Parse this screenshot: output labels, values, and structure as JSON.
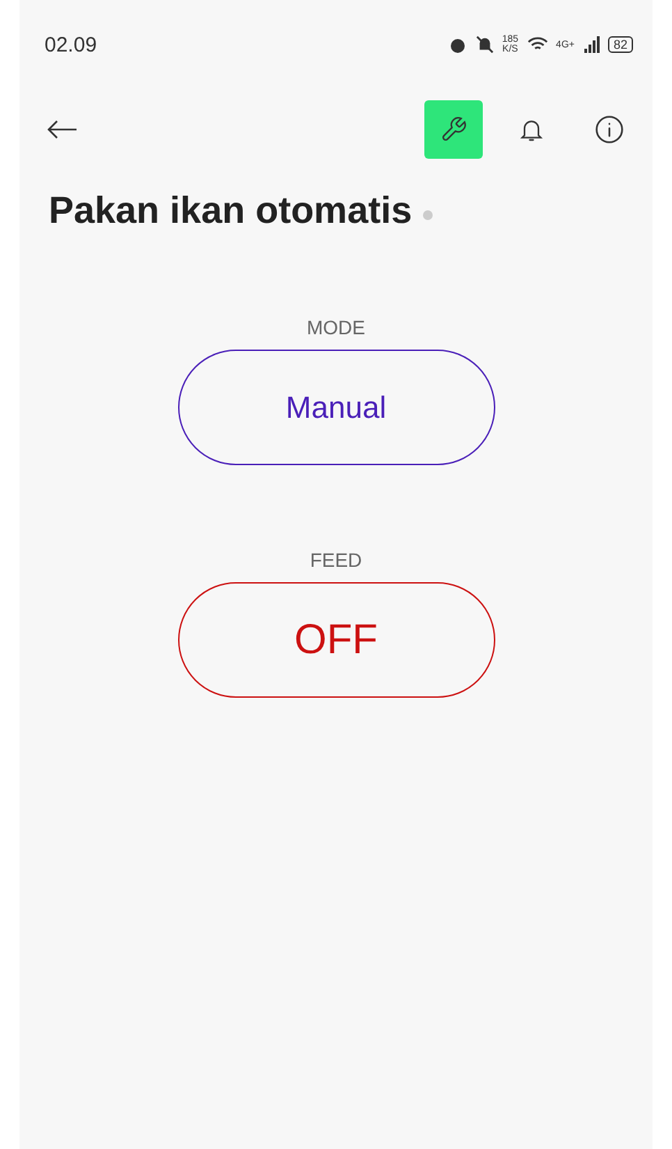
{
  "status_bar": {
    "time": "02.09",
    "speed": "185",
    "speed_unit": "K/S",
    "network": "4G+",
    "battery": "82"
  },
  "toolbar": {
    "buttons": [
      {
        "kind": "wrench",
        "selected": true
      },
      {
        "kind": "bell",
        "selected": false
      },
      {
        "kind": "info",
        "selected": false
      }
    ]
  },
  "title": "Pakan ikan otomatis",
  "controls": [
    {
      "label": "MODE",
      "value": "Manual",
      "color": "#4a1fb8"
    },
    {
      "label": "FEED",
      "value": "OFF",
      "color": "#cc1111"
    }
  ]
}
